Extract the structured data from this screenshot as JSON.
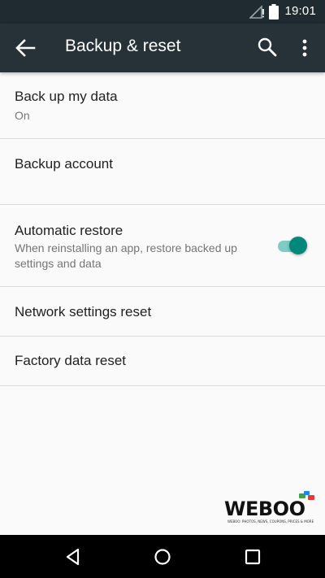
{
  "status_bar": {
    "time": "19:01",
    "signal_icon": "signal-no-data-icon",
    "battery_icon": "battery-icon"
  },
  "app_bar": {
    "title": "Backup & reset",
    "back_icon": "arrow-back-icon",
    "search_icon": "search-icon",
    "more_icon": "more-vert-icon",
    "color": "#263238"
  },
  "settings": {
    "items": [
      {
        "title": "Back up my data",
        "summary": "On"
      },
      {
        "title": "Backup account",
        "summary": ""
      },
      {
        "title": "Automatic restore",
        "summary": "When reinstalling an app, restore backed up settings and data",
        "toggle_on": true
      },
      {
        "title": "Network settings reset"
      },
      {
        "title": "Factory data reset"
      }
    ]
  },
  "accent_color": "#00897b",
  "watermark": {
    "text": "WEBOO",
    "tagline": "WEBOO: PHOTOS, NEWS, COUPONS, PRICES & MORE"
  },
  "nav_bar": {
    "back_icon": "triangle-back-icon",
    "home_icon": "circle-home-icon",
    "recents_icon": "square-recents-icon"
  }
}
